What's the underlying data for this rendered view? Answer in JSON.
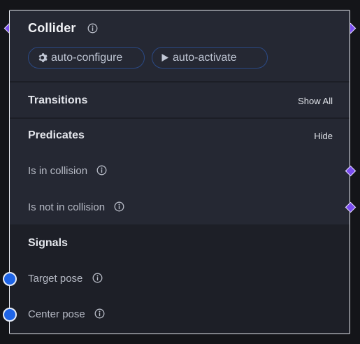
{
  "node": {
    "title": "Collider",
    "pills": {
      "configure_label": "auto-configure",
      "activate_label": "auto-activate"
    },
    "transitions": {
      "title": "Transitions",
      "action": "Show All"
    },
    "predicates": {
      "title": "Predicates",
      "action": "Hide",
      "items": [
        {
          "label": "Is in collision"
        },
        {
          "label": "Is not in collision"
        }
      ]
    },
    "signals": {
      "title": "Signals",
      "items": [
        {
          "label": "Target pose"
        },
        {
          "label": "Center pose"
        }
      ]
    }
  },
  "icons": {
    "title_info": "info-icon",
    "configure": "gear-icon",
    "activate": "play-icon"
  },
  "colors": {
    "node_background": "#252833",
    "signals_background": "#1d1f27",
    "pill_border": "#2b4a86",
    "predicate_port": "#7a4df0",
    "signal_port": "#1e64e6",
    "node_border": "#e6e8ee"
  }
}
